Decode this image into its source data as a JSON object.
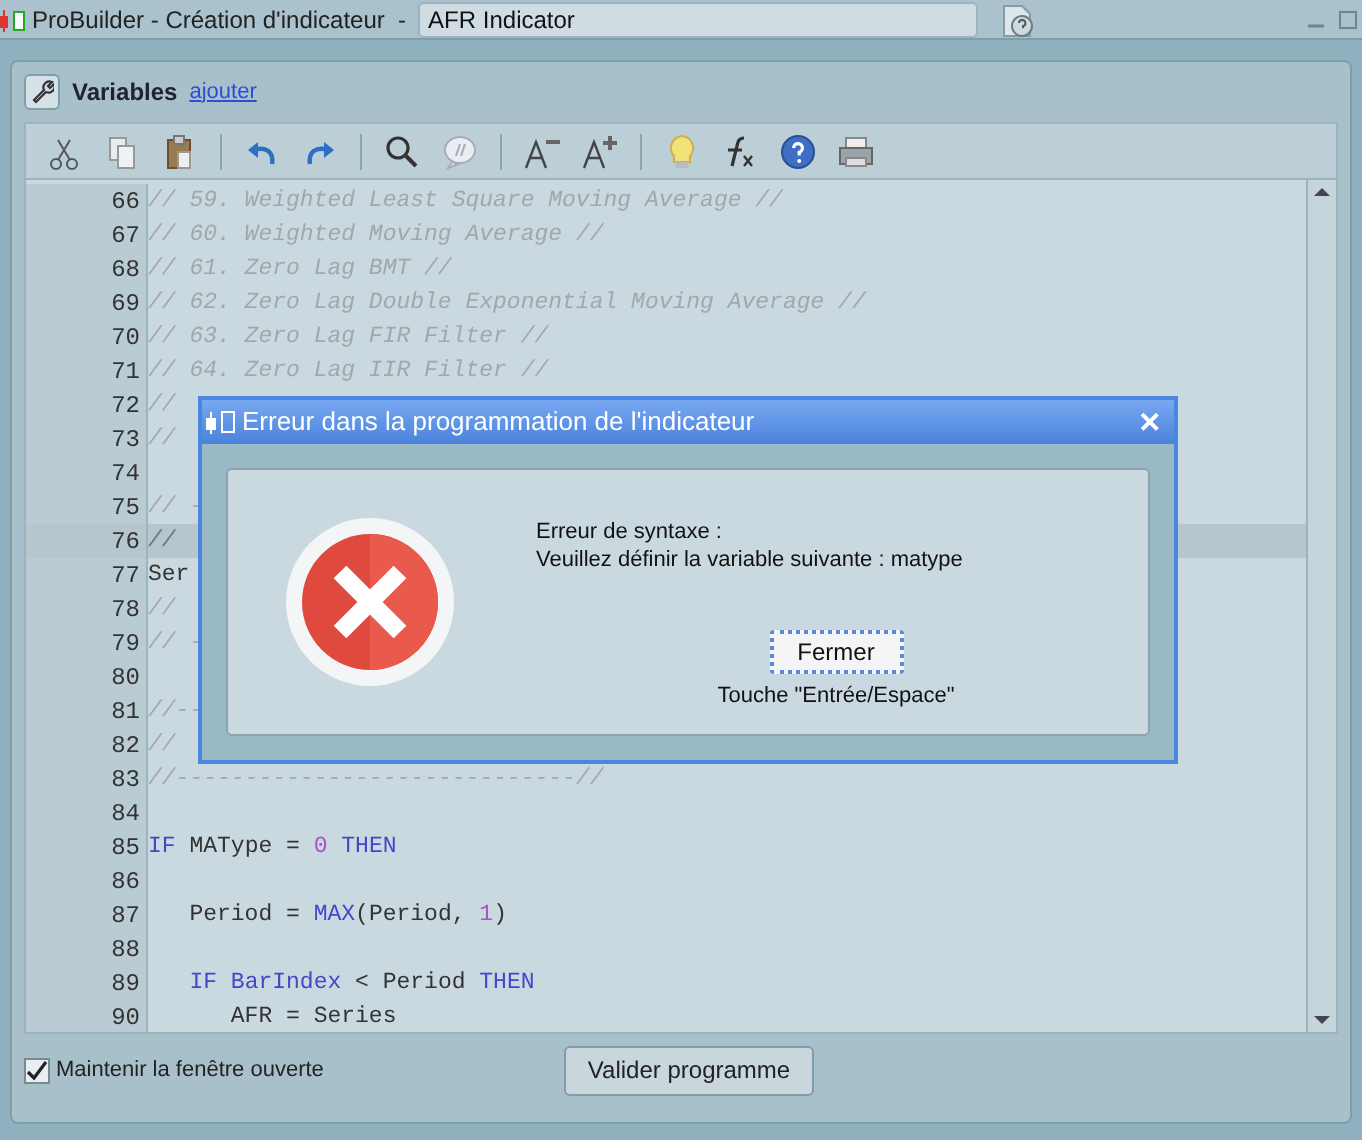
{
  "window": {
    "title": "ProBuilder - Création d'indicateur  -",
    "name_field": "AFR Indicator"
  },
  "variables": {
    "title": "Variables",
    "link": "ajouter"
  },
  "editor": {
    "lines": [
      {
        "number": "66",
        "current": false,
        "tokens": [
          {
            "kind": "comment",
            "text": "// 59. Weighted Least Square Moving Average //"
          }
        ]
      },
      {
        "number": "67",
        "current": false,
        "tokens": [
          {
            "kind": "comment",
            "text": "// 60. Weighted Moving Average //"
          }
        ]
      },
      {
        "number": "68",
        "current": false,
        "tokens": [
          {
            "kind": "comment",
            "text": "// 61. Zero Lag BMT //"
          }
        ]
      },
      {
        "number": "69",
        "current": false,
        "tokens": [
          {
            "kind": "comment",
            "text": "// 62. Zero Lag Double Exponential Moving Average //"
          }
        ]
      },
      {
        "number": "70",
        "current": false,
        "tokens": [
          {
            "kind": "comment",
            "text": "// 63. Zero Lag FIR Filter //"
          }
        ]
      },
      {
        "number": "71",
        "current": false,
        "tokens": [
          {
            "kind": "comment",
            "text": "// 64. Zero Lag IIR Filter //"
          }
        ]
      },
      {
        "number": "72",
        "current": false,
        "tokens": [
          {
            "kind": "comment",
            "text": "//"
          }
        ]
      },
      {
        "number": "73",
        "current": false,
        "tokens": [
          {
            "kind": "comment",
            "text": "//"
          }
        ]
      },
      {
        "number": "74",
        "current": false
      },
      {
        "number": "75",
        "current": false,
        "tokens": [
          {
            "kind": "comment",
            "text": "// -"
          }
        ]
      },
      {
        "number": "76",
        "current": true,
        "tokens": [
          {
            "kind": "comment",
            "text": "//"
          }
        ]
      },
      {
        "number": "77",
        "current": false,
        "tokens": [
          {
            "kind": "plain",
            "text": "Ser"
          }
        ]
      },
      {
        "number": "78",
        "current": false,
        "tokens": [
          {
            "kind": "comment",
            "text": "//"
          }
        ]
      },
      {
        "number": "79",
        "current": false,
        "tokens": [
          {
            "kind": "comment",
            "text": "// -"
          }
        ]
      },
      {
        "number": "80",
        "current": false
      },
      {
        "number": "81",
        "current": false,
        "tokens": [
          {
            "kind": "comment",
            "text": "//--"
          }
        ]
      },
      {
        "number": "82",
        "current": false,
        "tokens": [
          {
            "kind": "comment",
            "text": "//"
          }
        ]
      },
      {
        "number": "83",
        "current": false,
        "tokens": [
          {
            "kind": "comment",
            "text": "//-----------------------------//"
          }
        ]
      },
      {
        "number": "84",
        "current": false
      },
      {
        "number": "85",
        "current": false,
        "tokens": [
          {
            "kind": "keyword",
            "text": "IF"
          },
          {
            "kind": "plain",
            "text": " MAType = "
          },
          {
            "kind": "number",
            "text": "0"
          },
          {
            "kind": "keyword",
            "text": " THEN"
          }
        ]
      },
      {
        "number": "86",
        "current": false
      },
      {
        "number": "87",
        "current": false,
        "tokens": [
          {
            "kind": "plain",
            "text": "   Period = "
          },
          {
            "kind": "keyword",
            "text": "MAX"
          },
          {
            "kind": "plain",
            "text": "(Period, "
          },
          {
            "kind": "number",
            "text": "1"
          },
          {
            "kind": "plain",
            "text": ")"
          }
        ]
      },
      {
        "number": "88",
        "current": false
      },
      {
        "number": "89",
        "current": false,
        "tokens": [
          {
            "kind": "keyword",
            "text": "   IF"
          },
          {
            "kind": "keyword",
            "text": " BarIndex"
          },
          {
            "kind": "plain",
            "text": " < Period "
          },
          {
            "kind": "keyword",
            "text": "THEN"
          }
        ]
      },
      {
        "number": "90",
        "current": false,
        "tokens": [
          {
            "kind": "plain",
            "text": "      AFR = Series"
          }
        ]
      }
    ]
  },
  "dialog": {
    "title": "Erreur dans la programmation de l'indicateur",
    "close": "✕",
    "message_lines": [
      "Erreur de syntaxe :",
      "Veuillez définir la variable suivante : matype"
    ],
    "button": "Fermer",
    "hint": "Touche \"Entrée/Espace\""
  },
  "footer": {
    "keep_open": {
      "label": "Maintenir la fenêtre ouverte",
      "checked": true
    },
    "validate_button": "Valider programme"
  }
}
